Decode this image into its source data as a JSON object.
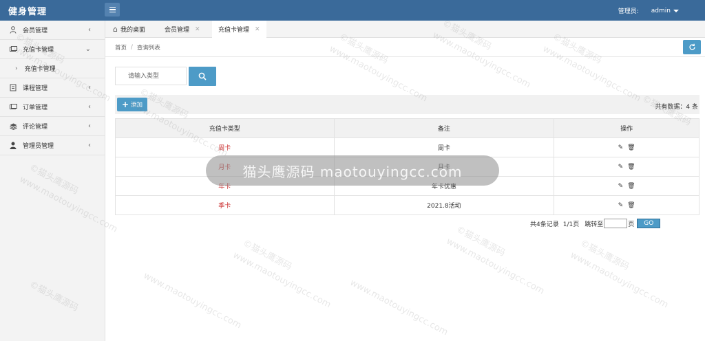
{
  "app": {
    "title": "健身管理"
  },
  "header": {
    "admin_label": "管理员:",
    "admin_name": "admin"
  },
  "sidebar": {
    "items": [
      {
        "label": "会员管理",
        "icon": "user-icon",
        "arrow": "‹"
      },
      {
        "label": "充值卡管理",
        "icon": "card-icon",
        "arrow": "⌄"
      },
      {
        "label": "课程管理",
        "icon": "book-icon",
        "arrow": "‹"
      },
      {
        "label": "订单管理",
        "icon": "order-icon",
        "arrow": "‹"
      },
      {
        "label": "评论管理",
        "icon": "layers-icon",
        "arrow": "‹"
      },
      {
        "label": "管理员管理",
        "icon": "person-icon",
        "arrow": "‹"
      }
    ],
    "sub_item": {
      "label": "充值卡管理"
    }
  },
  "tabs": [
    {
      "label": "我的桌面"
    },
    {
      "label": "会员管理"
    },
    {
      "label": "充值卡管理"
    }
  ],
  "breadcrumb": {
    "home": "首页",
    "sep": "/",
    "current": "查询列表"
  },
  "search": {
    "placeholder": "请输入类型"
  },
  "toolbar": {
    "add_label": "添加",
    "total_text": "共有数据：4 条"
  },
  "table": {
    "headers": [
      "充值卡类型",
      "备注",
      "操作"
    ],
    "rows": [
      {
        "type": "周卡",
        "note": "周卡"
      },
      {
        "type": "月卡",
        "note": "月卡"
      },
      {
        "type": "年卡",
        "note": "年卡优惠"
      },
      {
        "type": "季卡",
        "note": "2021.8活动"
      }
    ]
  },
  "pager": {
    "records": "共4条记录",
    "pages": "1/1页",
    "jump_label": "跳转至",
    "page_unit": "页",
    "go_label": "GO"
  },
  "watermark": {
    "text": "©猫头鹰源码",
    "url": "www.maotouyingcc.com",
    "center": "猫头鹰源码 maotouyingcc.com"
  },
  "colors": {
    "topbar": "#3a6a9a",
    "accent": "#4d9bc7",
    "card_type": "#cc3333"
  }
}
